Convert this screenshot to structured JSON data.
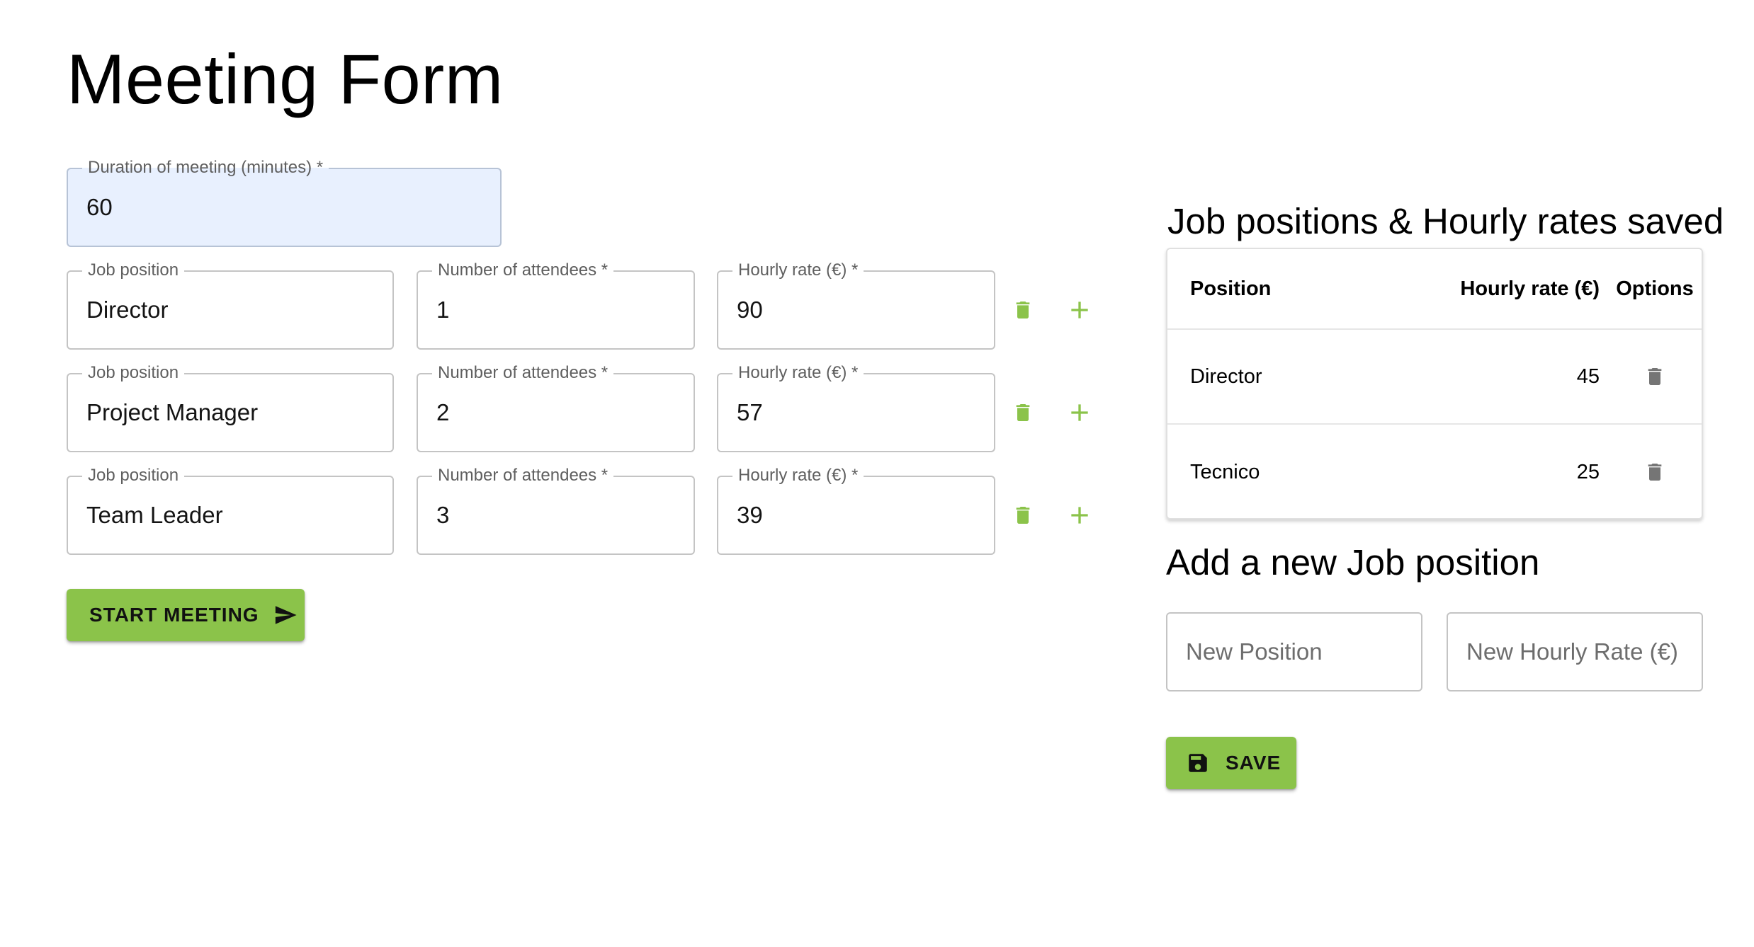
{
  "page_title": "Meeting Form",
  "duration": {
    "label": "Duration of meeting (minutes) *",
    "value": "60"
  },
  "attendee_rows": [
    {
      "job_label": "Job position",
      "job_value": "Director",
      "count_label": "Number of attendees *",
      "count_value": "1",
      "rate_label": "Hourly rate (€) *",
      "rate_value": "90"
    },
    {
      "job_label": "Job position",
      "job_value": "Project Manager",
      "count_label": "Number of attendees *",
      "count_value": "2",
      "rate_label": "Hourly rate (€) *",
      "rate_value": "57"
    },
    {
      "job_label": "Job position",
      "job_value": "Team Leader",
      "count_label": "Number of attendees *",
      "count_value": "3",
      "rate_label": "Hourly rate (€) *",
      "rate_value": "39"
    }
  ],
  "start_button": {
    "label": "START MEETING",
    "icon": "send-icon"
  },
  "saved_section": {
    "title": "Job positions & Hourly rates saved",
    "columns": [
      "Position",
      "Hourly rate (€)",
      "Options"
    ],
    "rows": [
      {
        "position": "Director",
        "rate": "45",
        "option_icon": "delete-icon"
      },
      {
        "position": "Tecnico",
        "rate": "25",
        "option_icon": "delete-icon"
      }
    ]
  },
  "add_section": {
    "title": "Add a new Job position",
    "position_placeholder": "New Position",
    "rate_placeholder": "New Hourly Rate (€)",
    "save_label": "SAVE",
    "save_icon": "floppy-disk-icon"
  },
  "colors": {
    "accent": "#8bc34a",
    "row_icon_green": "#8bc34a",
    "table_icon_gray": "#757575",
    "autofill_bg": "#e8f0fe"
  }
}
